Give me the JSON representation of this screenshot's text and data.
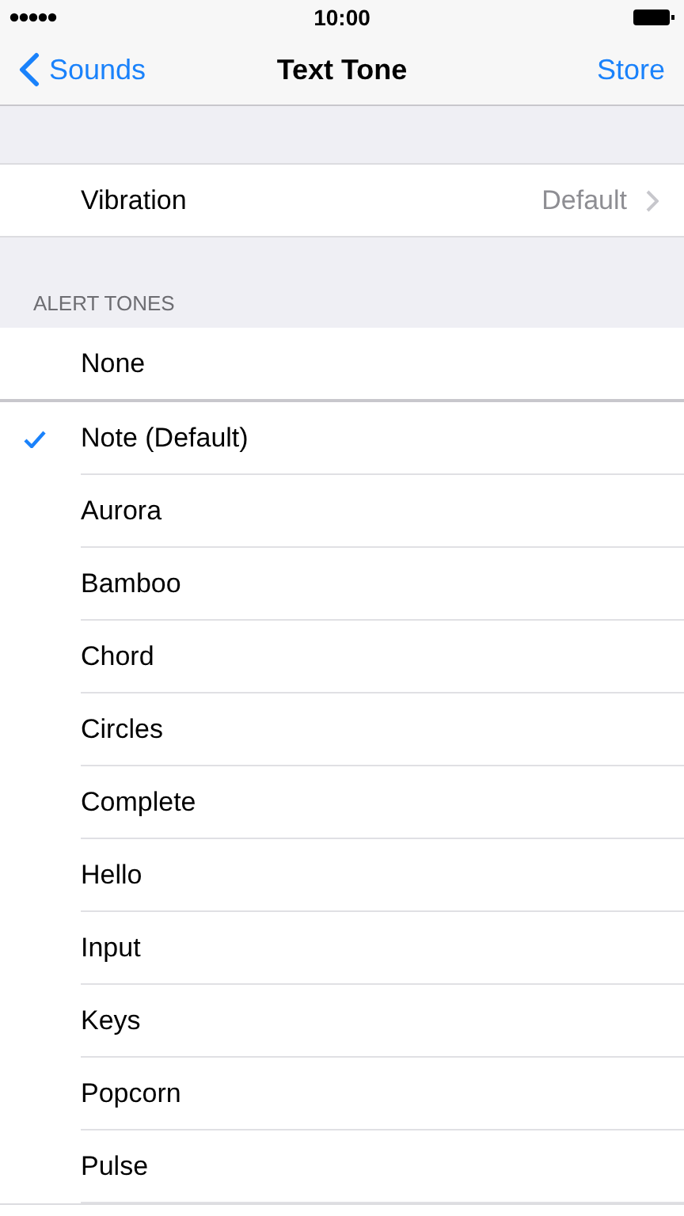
{
  "status_bar": {
    "time": "10:00"
  },
  "nav_bar": {
    "back": "Sounds",
    "title": "Text Tone",
    "action": "Store"
  },
  "vibration": {
    "label": "Vibration",
    "value": "Default"
  },
  "alert_tones": {
    "header": "ALERT TONES",
    "none_option": {
      "label": "None",
      "selected": false
    },
    "tones": [
      {
        "label": "Note (Default)",
        "selected": true
      },
      {
        "label": "Aurora",
        "selected": false
      },
      {
        "label": "Bamboo",
        "selected": false
      },
      {
        "label": "Chord",
        "selected": false
      },
      {
        "label": "Circles",
        "selected": false
      },
      {
        "label": "Complete",
        "selected": false
      },
      {
        "label": "Hello",
        "selected": false
      },
      {
        "label": "Input",
        "selected": false
      },
      {
        "label": "Keys",
        "selected": false
      },
      {
        "label": "Popcorn",
        "selected": false
      },
      {
        "label": "Pulse",
        "selected": false
      }
    ]
  }
}
